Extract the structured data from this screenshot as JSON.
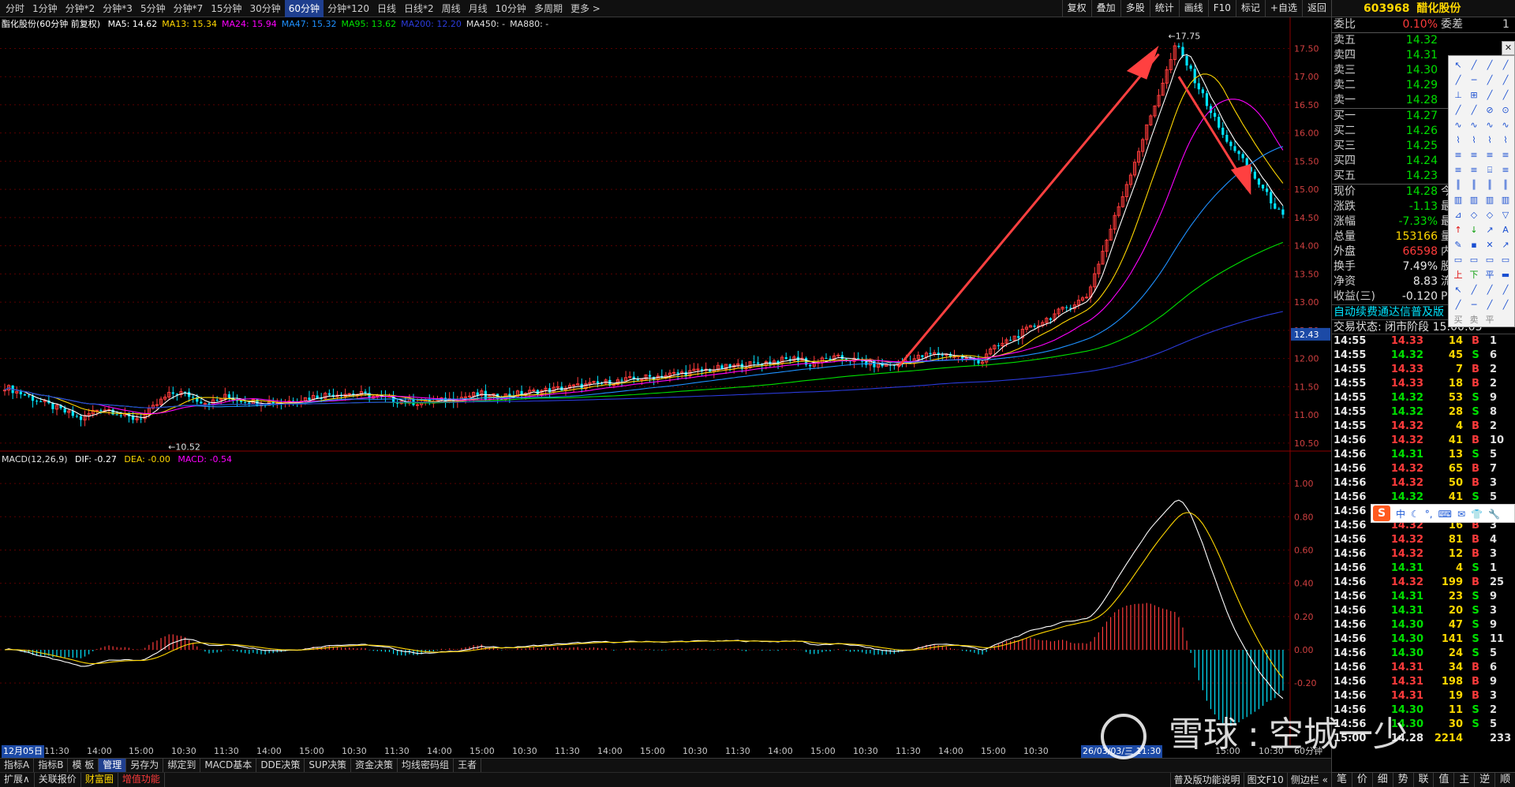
{
  "toolbar": {
    "period_tabs": [
      "分时",
      "1分钟",
      "分钟*2",
      "分钟*3",
      "5分钟",
      "分钟*7",
      "15分钟",
      "30分钟",
      "60分钟",
      "分钟*120",
      "日线",
      "日线*2",
      "周线",
      "月线",
      "10分钟",
      "多周期",
      "更多 >"
    ],
    "active_period": "60分钟",
    "tool_buttons": [
      "复权",
      "叠加",
      "多股",
      "统计",
      "画线",
      "F10",
      "标记",
      "+自选",
      "返回"
    ]
  },
  "indicator_line": {
    "title": "酯化股份(60分钟 前复权)",
    "ma": [
      {
        "label": "MA5: 14.62",
        "color": "#ffffff"
      },
      {
        "label": "MA13: 15.34",
        "color": "#ffd700"
      },
      {
        "label": "MA24: 15.94",
        "color": "#ff00ff"
      },
      {
        "label": "MA47: 15.32",
        "color": "#1e90ff"
      },
      {
        "label": "MA95: 13.62",
        "color": "#00e000"
      },
      {
        "label": "MA200: 12.20",
        "color": "#2b3bdb"
      },
      {
        "label": "MA450: -",
        "color": "#e0e0e0"
      },
      {
        "label": "MA880: -",
        "color": "#e0e0e0"
      }
    ]
  },
  "macd_line": {
    "title": "MACD(12,26,9)",
    "dif": "DIF: -0.27",
    "dea": "DEA: -0.00",
    "macd": "MACD: -0.54"
  },
  "chart_data": [
    {
      "type": "candlestick",
      "title": "酯化股份(60分钟 前复权)",
      "y_ticks": [
        "17.50",
        "17.00",
        "16.50",
        "16.00",
        "15.50",
        "15.00",
        "14.50",
        "14.00",
        "13.50",
        "13.00",
        "12.50",
        "12.00",
        "11.50",
        "11.00",
        "10.50"
      ],
      "ylim": [
        10.4,
        17.8
      ],
      "annotations": {
        "high_label": "17.75",
        "low_label": "10.52",
        "current_price_tag": "12.43"
      },
      "ohlc_summary": {
        "low": 10.52,
        "high": 17.75,
        "last": 14.28
      },
      "series": [
        {
          "name": "MA5",
          "color": "#ffffff"
        },
        {
          "name": "MA13",
          "color": "#ffd700"
        },
        {
          "name": "MA24",
          "color": "#ff00ff"
        },
        {
          "name": "MA47",
          "color": "#1e90ff"
        },
        {
          "name": "MA95",
          "color": "#00e000"
        },
        {
          "name": "MA200",
          "color": "#2b3bdb"
        }
      ]
    },
    {
      "type": "bar",
      "title": "MACD(12,26,9)",
      "y_ticks": [
        "1.00",
        "0.80",
        "0.60",
        "0.40",
        "0.20",
        "0.00",
        "-0.20"
      ],
      "ylim": [
        -0.55,
        1.1
      ],
      "series": [
        {
          "name": "DIF",
          "color": "#ffffff"
        },
        {
          "name": "DEA",
          "color": "#ffd700"
        },
        {
          "name": "MACD",
          "color": "#ff00ff"
        }
      ]
    }
  ],
  "time_axis": [
    "12月05日",
    "11:30",
    "14:00",
    "15:00",
    "10:30",
    "11:30",
    "14:00",
    "15:00",
    "10:30",
    "11:30",
    "14:00",
    "15:00",
    "10:30",
    "11:30",
    "14:00",
    "15:00",
    "10:30",
    "11:30",
    "14:00",
    "15:00",
    "10:30",
    "11:30",
    "14:00",
    "15:00",
    "10:30",
    "26/03/03/三 11:30",
    "15:00",
    "10:30"
  ],
  "time_axis_right_label": "60分钟",
  "bottom_tabs_row1": [
    "指标A",
    "指标B",
    "模 板",
    "管理",
    "另存为",
    "绑定到",
    "MACD基本",
    "DDE决策",
    "SUP决策",
    "资金决策",
    "均线密码组",
    "王者"
  ],
  "bottom_tabs_row2": [
    "扩展∧",
    "关联报价",
    "财富圈",
    "增值功能"
  ],
  "status_bar": [
    "普及版功能说明",
    "图文F10",
    "侧边栏 «"
  ],
  "stock": {
    "code": "603968",
    "name": "醋化股份"
  },
  "order_book": {
    "weibi_label": "委比",
    "weibi_val": "0.10%",
    "weicha_label": "委差",
    "weicha_val": "1",
    "asks": [
      {
        "label": "卖五",
        "price": "14.32"
      },
      {
        "label": "卖四",
        "price": "14.31"
      },
      {
        "label": "卖三",
        "price": "14.30"
      },
      {
        "label": "卖二",
        "price": "14.29"
      },
      {
        "label": "卖一",
        "price": "14.28"
      }
    ],
    "bids": [
      {
        "label": "买一",
        "price": "14.27"
      },
      {
        "label": "买二",
        "price": "14.26"
      },
      {
        "label": "买三",
        "price": "14.25"
      },
      {
        "label": "买四",
        "price": "14.24"
      },
      {
        "label": "买五",
        "price": "14.23"
      }
    ]
  },
  "quote": [
    {
      "l": "现价",
      "v": "14.28",
      "c": "green",
      "l2": "今开"
    },
    {
      "l": "涨跌",
      "v": "-1.13",
      "c": "green",
      "l2": "最高"
    },
    {
      "l": "涨幅",
      "v": "-7.33%",
      "c": "green",
      "l2": "最低"
    },
    {
      "l": "总量",
      "v": "153166",
      "c": "yellow",
      "l2": "量比"
    },
    {
      "l": "外盘",
      "v": "66598",
      "c": "red",
      "l2": "内盘"
    },
    {
      "l": "换手",
      "v": "7.49%",
      "c": "white",
      "l2": "股本"
    },
    {
      "l": "净资",
      "v": "8.83",
      "c": "white",
      "l2": "流通"
    },
    {
      "l": "收益(三)",
      "v": "-0.120",
      "c": "white",
      "l2": "PE(动"
    }
  ],
  "ticker_banner": "自动续费通达信普及版 30元/月",
  "trade_status": "交易状态: 闭市阶段 15:00:05",
  "ticks": [
    [
      "14:55",
      "14.33",
      "14",
      "B",
      "1",
      "red"
    ],
    [
      "14:55",
      "14.32",
      "45",
      "S",
      "6",
      "green"
    ],
    [
      "14:55",
      "14.33",
      "7",
      "B",
      "2",
      "red"
    ],
    [
      "14:55",
      "14.33",
      "18",
      "B",
      "2",
      "red"
    ],
    [
      "14:55",
      "14.32",
      "53",
      "S",
      "9",
      "green"
    ],
    [
      "14:55",
      "14.32",
      "28",
      "S",
      "8",
      "green"
    ],
    [
      "14:55",
      "14.32",
      "4",
      "B",
      "2",
      "red"
    ],
    [
      "14:56",
      "14.32",
      "41",
      "B",
      "10",
      "red"
    ],
    [
      "14:56",
      "14.31",
      "13",
      "S",
      "5",
      "green"
    ],
    [
      "14:56",
      "14.32",
      "65",
      "B",
      "7",
      "red"
    ],
    [
      "14:56",
      "14.32",
      "50",
      "B",
      "3",
      "red"
    ],
    [
      "14:56",
      "14.32",
      "41",
      "S",
      "5",
      "green"
    ],
    [
      "14:56",
      "14.32",
      "41",
      "S",
      "5",
      "green"
    ],
    [
      "14:56",
      "14.32",
      "16",
      "B",
      "3",
      "red"
    ],
    [
      "14:56",
      "14.32",
      "81",
      "B",
      "4",
      "red"
    ],
    [
      "14:56",
      "14.32",
      "12",
      "B",
      "3",
      "red"
    ],
    [
      "14:56",
      "14.31",
      "4",
      "S",
      "1",
      "green"
    ],
    [
      "14:56",
      "14.32",
      "199",
      "B",
      "25",
      "red"
    ],
    [
      "14:56",
      "14.31",
      "23",
      "S",
      "9",
      "green"
    ],
    [
      "14:56",
      "14.31",
      "20",
      "S",
      "3",
      "green"
    ],
    [
      "14:56",
      "14.30",
      "47",
      "S",
      "9",
      "green"
    ],
    [
      "14:56",
      "14.30",
      "141",
      "S",
      "11",
      "green"
    ],
    [
      "14:56",
      "14.30",
      "24",
      "S",
      "5",
      "green"
    ],
    [
      "14:56",
      "14.31",
      "34",
      "B",
      "6",
      "red"
    ],
    [
      "14:56",
      "14.31",
      "198",
      "B",
      "9",
      "red"
    ],
    [
      "14:56",
      "14.31",
      "19",
      "B",
      "3",
      "red"
    ],
    [
      "14:56",
      "14.30",
      "11",
      "S",
      "2",
      "green"
    ],
    [
      "14:56",
      "14.30",
      "30",
      "S",
      "5",
      "green"
    ],
    [
      "15:00",
      "14.28",
      "2214",
      "",
      "233",
      "white"
    ]
  ],
  "right_bottom_tabs": [
    "笔",
    "价",
    "细",
    "势",
    "联",
    "值",
    "主",
    "逆",
    "顺"
  ],
  "watermark": {
    "brand": "雪球",
    "separator": ":",
    "author": "空城一少"
  },
  "ime": {
    "icons": [
      "中",
      "☾",
      "°,",
      "⌨",
      "✉",
      "👕",
      "🔧"
    ]
  }
}
